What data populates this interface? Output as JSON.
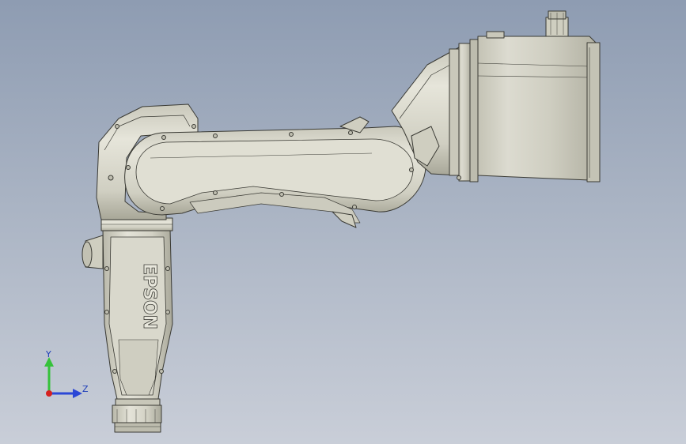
{
  "viewport": {
    "background_top": "#8e9cb2",
    "background_bottom": "#c9ced8"
  },
  "model": {
    "brand_text": "EPSON",
    "body_color": "#d6d5c8",
    "edge_color": "#3a3a34"
  },
  "triad": {
    "y_label": "Y",
    "z_label": "Z",
    "y_color": "#35c23a",
    "z_color": "#2b47d6",
    "x_color": "#d62020"
  }
}
